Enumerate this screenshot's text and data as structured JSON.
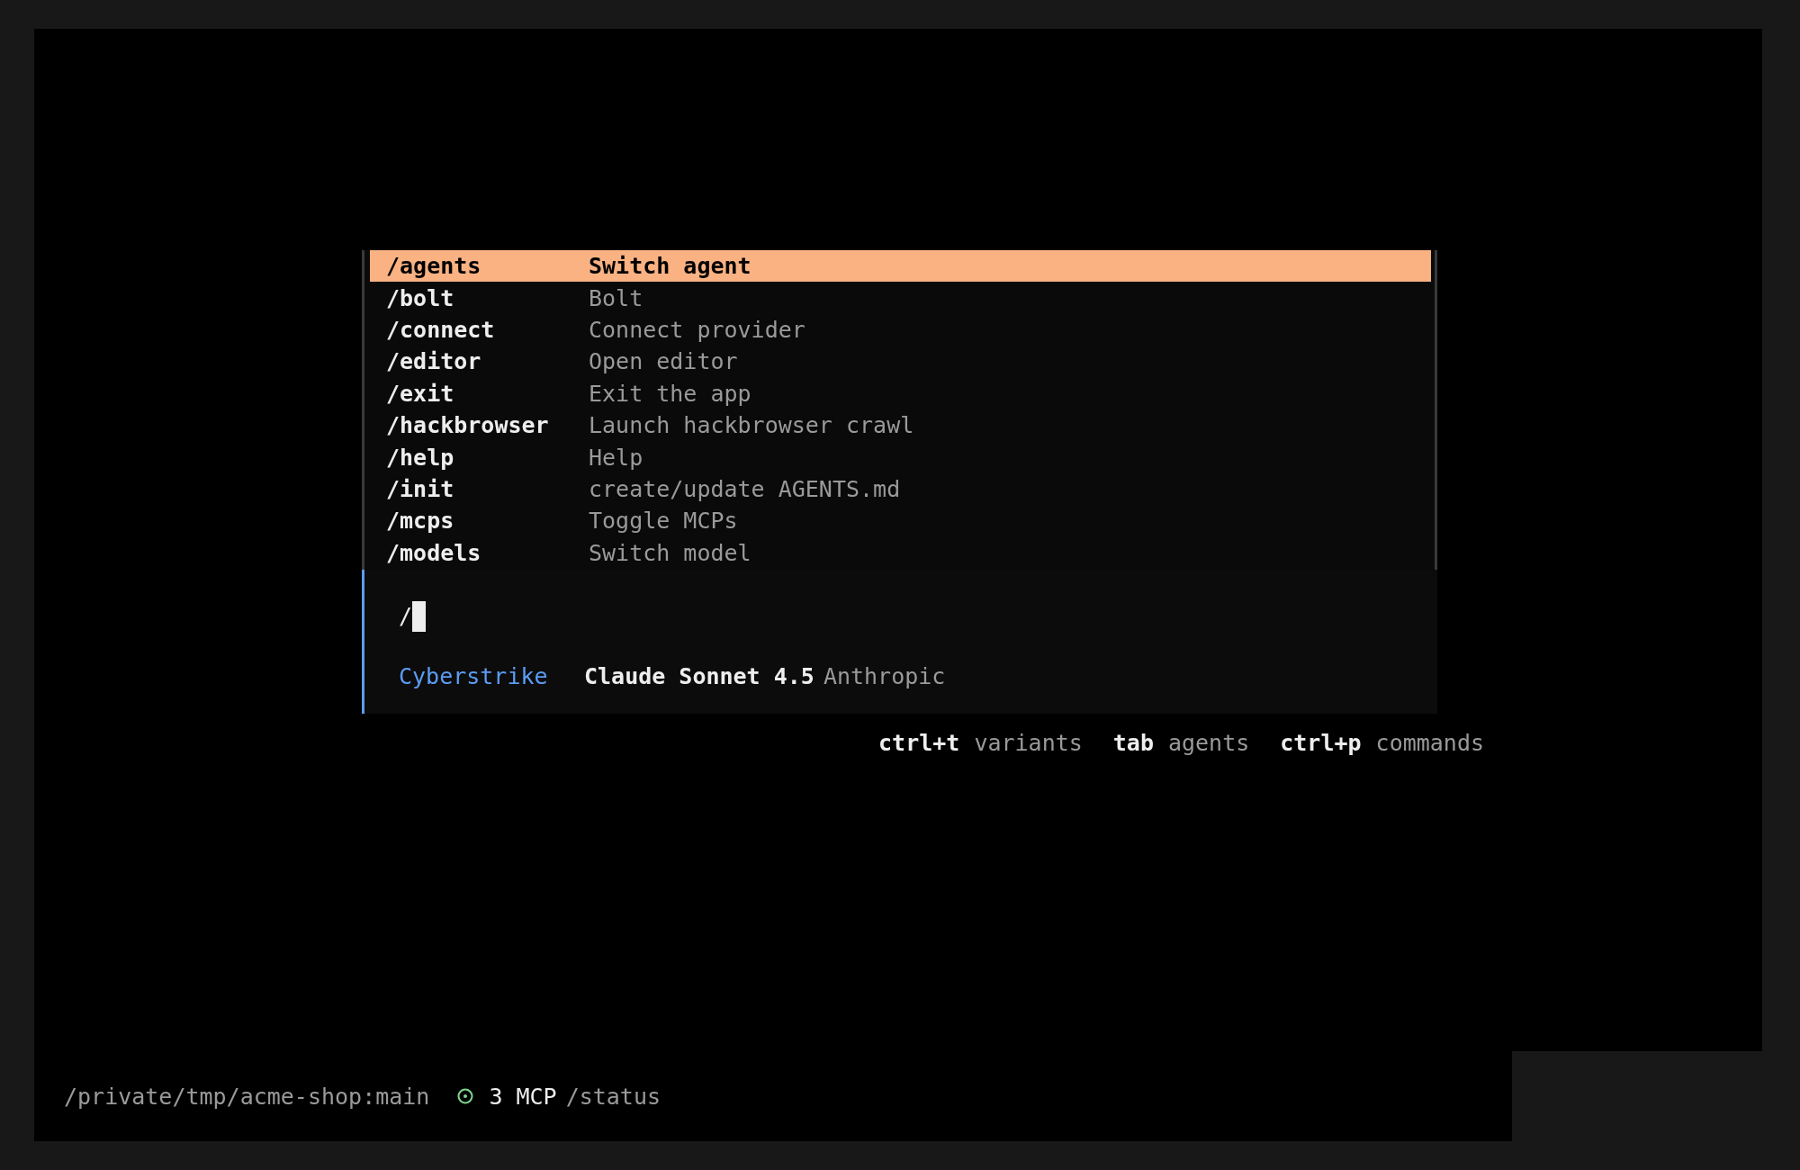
{
  "command_menu": {
    "items": [
      {
        "command": "/agents",
        "description": "Switch agent",
        "selected": true
      },
      {
        "command": "/bolt",
        "description": "Bolt",
        "selected": false
      },
      {
        "command": "/connect",
        "description": "Connect provider",
        "selected": false
      },
      {
        "command": "/editor",
        "description": "Open editor",
        "selected": false
      },
      {
        "command": "/exit",
        "description": "Exit the app",
        "selected": false
      },
      {
        "command": "/hackbrowser",
        "description": "Launch hackbrowser crawl",
        "selected": false
      },
      {
        "command": "/help",
        "description": "Help",
        "selected": false
      },
      {
        "command": "/init",
        "description": "create/update AGENTS.md",
        "selected": false
      },
      {
        "command": "/mcps",
        "description": "Toggle MCPs",
        "selected": false
      },
      {
        "command": "/models",
        "description": "Switch model",
        "selected": false
      }
    ]
  },
  "prompt": {
    "value": "/",
    "agent": "Cyberstrike",
    "model": "Claude Sonnet 4.5",
    "provider": "Anthropic"
  },
  "hints": [
    {
      "key": "ctrl+t",
      "label": "variants"
    },
    {
      "key": "tab",
      "label": "agents"
    },
    {
      "key": "ctrl+p",
      "label": "commands"
    }
  ],
  "status_bar": {
    "path": "/private/tmp/acme-shop:main",
    "mcp": "3 MCP",
    "command": "/status"
  }
}
